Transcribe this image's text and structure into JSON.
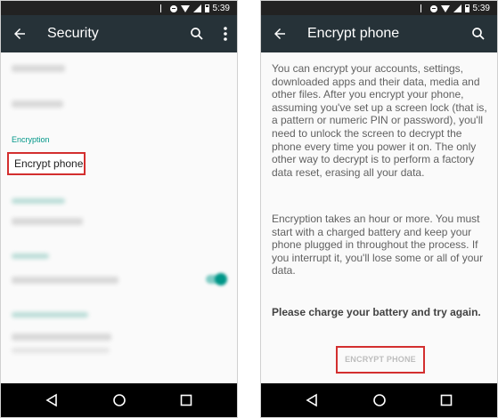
{
  "status_bar": {
    "time": "5:39"
  },
  "left_screen": {
    "title": "Security",
    "section_label": "Encryption",
    "encrypt_item_label": "Encrypt phone"
  },
  "right_screen": {
    "title": "Encrypt phone",
    "paragraph_1": "You can encrypt your accounts, settings, downloaded apps and their data, media and other files. After you encrypt your phone, assuming you've set up a screen lock (that is, a pattern or numeric PIN or password), you'll need to unlock the screen to decrypt the phone every time you power it on. The only other way to decrypt is to perform a factory data reset, erasing all your data.",
    "paragraph_2": "Encryption takes an hour or more. You must start with a charged battery and keep your phone plugged in throughout the process. If you interrupt it, you'll lose some or all of your data.",
    "warning": "Please charge your battery and try again.",
    "encrypt_button_label": "ENCRYPT PHONE",
    "encrypt_button_enabled": false
  },
  "icons": [
    "back-arrow-icon",
    "search-icon",
    "overflow-menu-icon",
    "nav-back-icon",
    "nav-home-icon",
    "nav-recents-icon",
    "bluetooth-icon",
    "dnd-icon",
    "wifi-icon",
    "signal-icon",
    "battery-icon"
  ],
  "colors": {
    "status_bar": "#222222",
    "app_bar": "#263238",
    "accent": "#009688",
    "highlight": "#d32f2f",
    "nav_bar": "#000000"
  }
}
